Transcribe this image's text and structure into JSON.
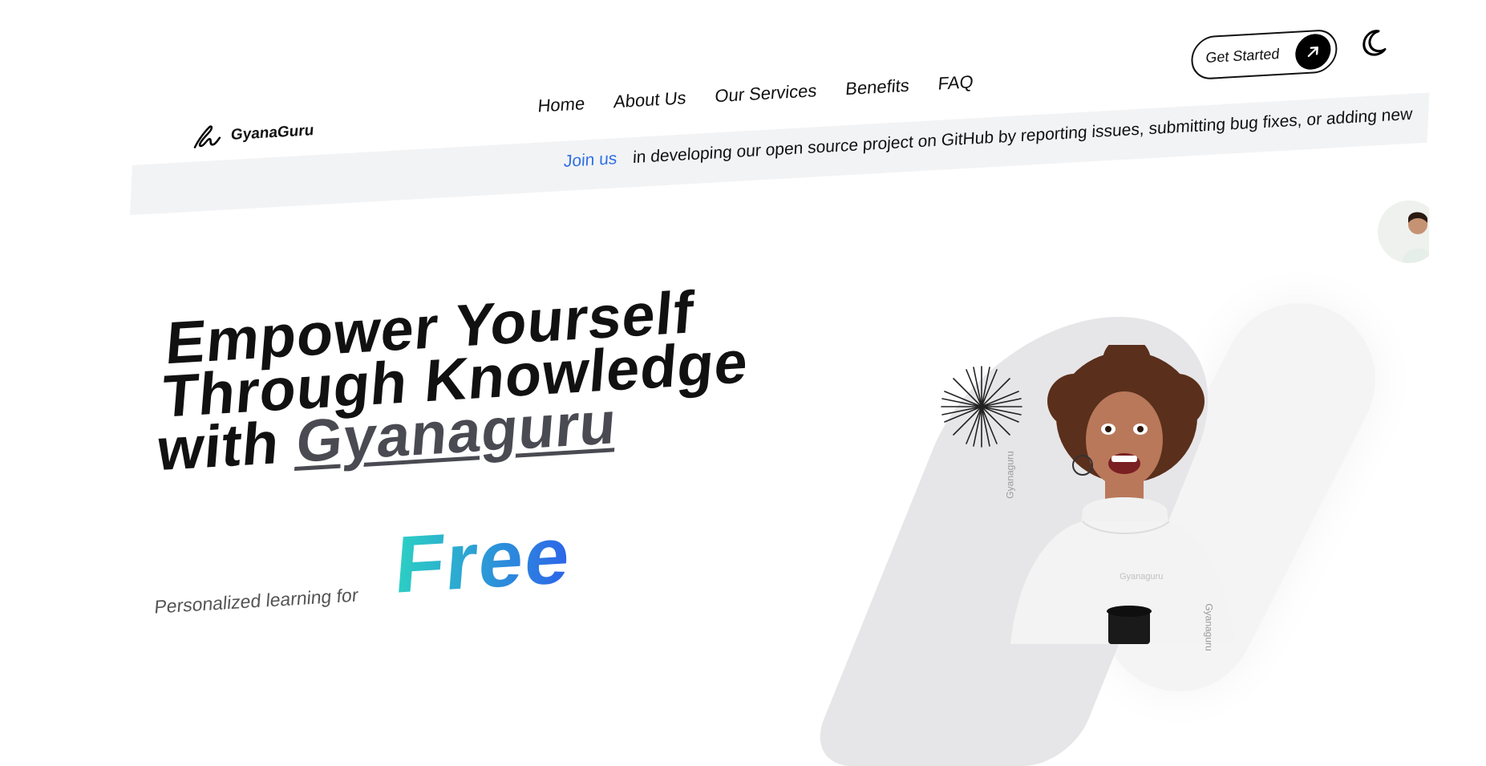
{
  "brand": {
    "name": "GyanaGuru"
  },
  "nav": [
    {
      "label": "Home"
    },
    {
      "label": "About Us"
    },
    {
      "label": "Our Services"
    },
    {
      "label": "Benefits"
    },
    {
      "label": "FAQ"
    }
  ],
  "header": {
    "cta_label": "Get Started"
  },
  "banner": {
    "link_label": "Join us",
    "text": "in developing our open source project on GitHub by reporting issues, submitting bug fixes, or adding new"
  },
  "hero": {
    "title_line1": "Empower Yourself",
    "title_line2": "Through Knowledge",
    "title_line3_prefix": "with ",
    "title_brand": "Gyanaguru",
    "lead": "Personalized learning for",
    "highlight": "Free"
  },
  "image": {
    "shirt_text": "Gyanaguru",
    "side_text": "Gyanaguru"
  },
  "colors": {
    "accent_blue": "#2f6fe6",
    "gradient_start": "#2cd1c3",
    "gradient_end": "#2d63ea",
    "banner_bg": "#f2f3f5"
  },
  "icons": [
    "gyanaguru-logo-icon",
    "arrow-up-right-icon",
    "moon-icon",
    "starburst-icon"
  ]
}
